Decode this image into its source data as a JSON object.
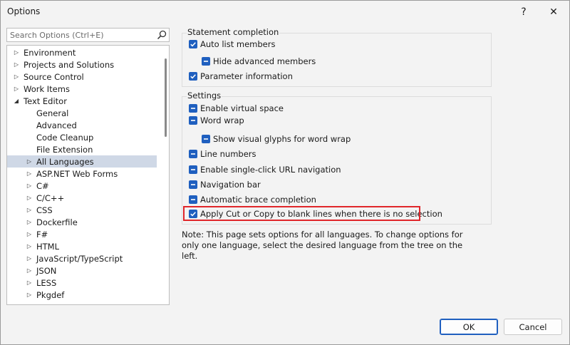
{
  "window": {
    "title": "Options",
    "help_glyph": "?",
    "close_glyph": "✕"
  },
  "search": {
    "placeholder": "Search Options (Ctrl+E)"
  },
  "tree": {
    "items": [
      {
        "label": "Environment",
        "arrow": "▷",
        "level": 0
      },
      {
        "label": "Projects and Solutions",
        "arrow": "▷",
        "level": 0
      },
      {
        "label": "Source Control",
        "arrow": "▷",
        "level": 0
      },
      {
        "label": "Work Items",
        "arrow": "▷",
        "level": 0
      },
      {
        "label": "Text Editor",
        "arrow": "◢",
        "level": 0
      },
      {
        "label": "General",
        "arrow": "",
        "level": 1
      },
      {
        "label": "Advanced",
        "arrow": "",
        "level": 1
      },
      {
        "label": "Code Cleanup",
        "arrow": "",
        "level": 1
      },
      {
        "label": "File Extension",
        "arrow": "",
        "level": 1
      },
      {
        "label": "All Languages",
        "arrow": "▷",
        "level": 1,
        "selected": true
      },
      {
        "label": "ASP.NET Web Forms",
        "arrow": "▷",
        "level": 1
      },
      {
        "label": "C#",
        "arrow": "▷",
        "level": 1
      },
      {
        "label": "C/C++",
        "arrow": "▷",
        "level": 1
      },
      {
        "label": "CSS",
        "arrow": "▷",
        "level": 1
      },
      {
        "label": "Dockerfile",
        "arrow": "▷",
        "level": 1
      },
      {
        "label": "F#",
        "arrow": "▷",
        "level": 1
      },
      {
        "label": "HTML",
        "arrow": "▷",
        "level": 1
      },
      {
        "label": "JavaScript/TypeScript",
        "arrow": "▷",
        "level": 1
      },
      {
        "label": "JSON",
        "arrow": "▷",
        "level": 1
      },
      {
        "label": "LESS",
        "arrow": "▷",
        "level": 1
      },
      {
        "label": "Pkgdef",
        "arrow": "▷",
        "level": 1
      }
    ]
  },
  "statement_completion": {
    "title": "Statement completion",
    "options": [
      {
        "label": "Auto list members",
        "state": "checked"
      },
      {
        "label": "Hide advanced members",
        "state": "indeterminate"
      },
      {
        "label": "Parameter information",
        "state": "checked"
      }
    ]
  },
  "settings": {
    "title": "Settings",
    "options": [
      {
        "label": "Enable virtual space",
        "state": "indeterminate"
      },
      {
        "label": "Word wrap",
        "state": "indeterminate"
      },
      {
        "label": "Show visual glyphs for word wrap",
        "state": "indeterminate"
      },
      {
        "label": "Line numbers",
        "state": "indeterminate"
      },
      {
        "label": "Enable single-click URL navigation",
        "state": "indeterminate"
      },
      {
        "label": "Navigation bar",
        "state": "indeterminate"
      },
      {
        "label": "Automatic brace completion",
        "state": "indeterminate"
      },
      {
        "label": "Apply Cut or Copy to blank lines when there is no selection",
        "state": "checked"
      }
    ]
  },
  "note": "Note: This page sets options for all languages. To change options for only one language, select the desired language from the tree on the left.",
  "buttons": {
    "ok": "OK",
    "cancel": "Cancel"
  },
  "colors": {
    "accent": "#1f5fbf",
    "highlight_border": "#e0262a",
    "selected_row": "#cfd8e6"
  },
  "icons": {
    "search": "search-icon"
  }
}
